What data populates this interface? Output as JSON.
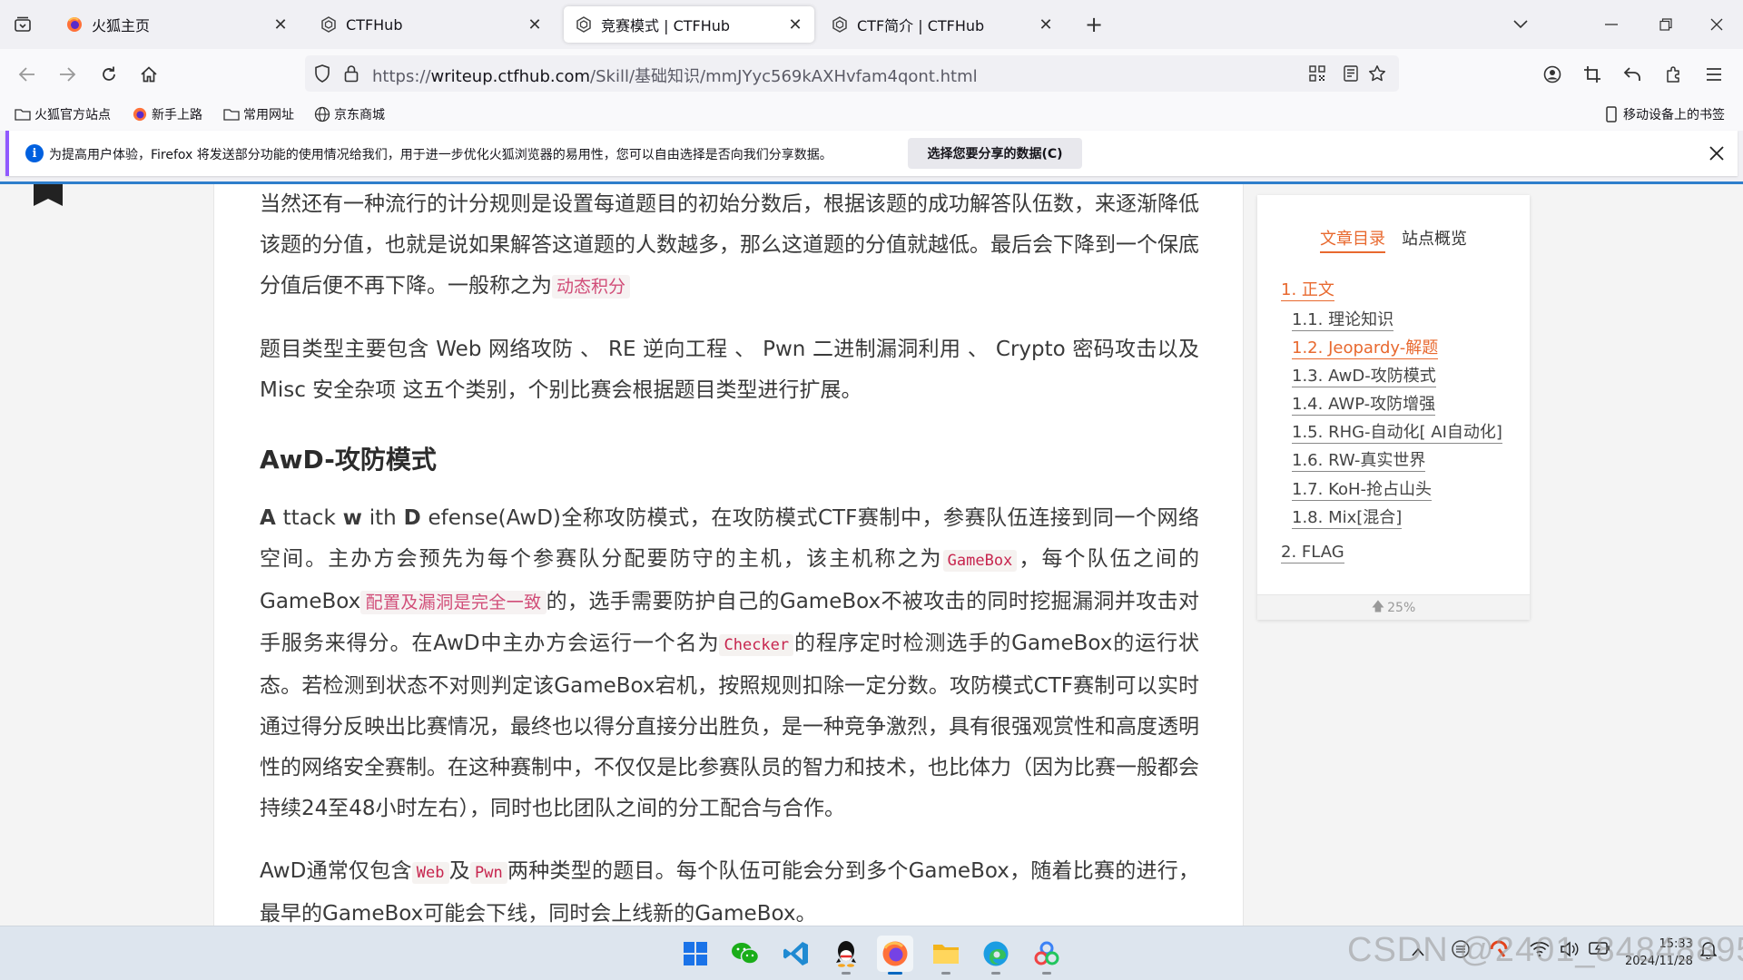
{
  "tabs": [
    {
      "title": "火狐主页",
      "active": false,
      "icon": "firefox-icon"
    },
    {
      "title": "CTFHub",
      "active": false,
      "icon": "ctfhub-icon"
    },
    {
      "title": "竞赛模式 | CTFHub",
      "active": true,
      "icon": "ctfhub-icon"
    },
    {
      "title": "CTF简介 | CTFHub",
      "active": false,
      "icon": "ctfhub-icon"
    }
  ],
  "url": {
    "scheme": "https://",
    "host": "writeup.ctfhub.com",
    "path": "/Skill/基础知识/mmJYyc569kAXHvfam4qont.html"
  },
  "bookmarks": [
    {
      "label": "火狐官方站点",
      "icon": "folder-icon"
    },
    {
      "label": "新手上路",
      "icon": "firefox-icon"
    },
    {
      "label": "常用网址",
      "icon": "folder-icon"
    },
    {
      "label": "京东商城",
      "icon": "globe-icon"
    }
  ],
  "mobile_bookmarks": "移动设备上的书签",
  "notification": {
    "text": "为提高用户体验，Firefox 将发送部分功能的使用情况给我们，用于进一步优化火狐浏览器的易用性，您可以自由选择是否向我们分享数据。",
    "button": "选择您要分享的数据(C)"
  },
  "article": {
    "p1": {
      "text": "当然还有一种流行的计分规则是设置每道题目的初始分数后，根据该题的成功解答队伍数，来逐渐降低该题的分值，也就是说如果解答这道题的人数越多，那么这道题的分值就越低。最后会下降到一个保底分值后便不再下降。一般称之为",
      "hl": "动态积分"
    },
    "p2": "题目类型主要包含 Web 网络攻防 、 RE 逆向工程 、 Pwn 二进制漏洞利用 、 Crypto 密码攻击以及 Misc 安全杂项 这五个类别，个别比赛会根据题目类型进行扩展。",
    "h2": "AwD-攻防模式",
    "p3": {
      "b1": "A",
      "t1": " ttack ",
      "b2": "w",
      "t2": " ith ",
      "b3": "D",
      "t3": " efense(AwD)全称攻防模式，在攻防模式CTF赛制中，参赛队伍连接到同一个网络空间。主办方会预先为每个参赛队分配要防守的主机，该主机称之为",
      "code1": "GameBox",
      "t4": "，每个队伍之间的GameBox",
      "hl1": "配置及漏洞是完全一致",
      "t5": "的，选手需要防护自己的GameBox不被攻击的同时挖掘漏洞并攻击对手服务来得分。在AwD中主办方会运行一个名为",
      "code2": "Checker",
      "t6": "的程序定时检测选手的GameBox的运行状态。若检测到状态不对则判定该GameBox宕机，按照规则扣除一定分数。攻防模式CTF赛制可以实时通过得分反映出比赛情况，最终也以得分直接分出胜负，是一种竞争激烈，具有很强观赏性和高度透明性的网络安全赛制。在这种赛制中，不仅仅是比参赛队员的智力和技术，也比体力（因为比赛一般都会持续24至48小时左右），同时也比团队之间的分工配合与合作。"
    },
    "p4": {
      "t1": "AwD通常仅包含",
      "code1": "Web",
      "t2": "及",
      "code2": "Pwn",
      "t3": "两种类型的题目。每个队伍可能会分到多个GameBox，随着比赛的进行，最早的GameBox可能会下线，同时会上线新的GameBox。"
    }
  },
  "toc": {
    "tabs": [
      "文章目录",
      "站点概览"
    ],
    "items": [
      {
        "label": "1. 正文",
        "level": 1,
        "active": true
      },
      {
        "label": "1.1. 理论知识",
        "level": 2,
        "active": false
      },
      {
        "label": "1.2. Jeopardy-解题",
        "level": 2,
        "active": true
      },
      {
        "label": "1.3. AwD-攻防模式",
        "level": 2,
        "active": false
      },
      {
        "label": "1.4. AWP-攻防增强",
        "level": 2,
        "active": false
      },
      {
        "label": "1.5. RHG-自动化[ AI自动化]",
        "level": 2,
        "active": false
      },
      {
        "label": "1.6. RW-真实世界",
        "level": 2,
        "active": false
      },
      {
        "label": "1.7. KoH-抢占山头",
        "level": 2,
        "active": false
      },
      {
        "label": "1.8. Mix[混合]",
        "level": 2,
        "active": false
      },
      {
        "label": "2. FLAG",
        "level": 1,
        "active": false
      }
    ],
    "progress": "25%"
  },
  "taskbar": {
    "apps": [
      "windows-start-icon",
      "wechat-icon",
      "vscode-icon",
      "qq-icon",
      "firefox-icon",
      "file-explorer-icon",
      "edge-icon",
      "app-icon"
    ],
    "time": "15:33",
    "date": "2024/11/28"
  },
  "watermark": "CSDN @2401_84848895",
  "colors": {
    "accent": "#e8692f",
    "link_blue": "#0060df",
    "code_pink": "#c7254e"
  }
}
